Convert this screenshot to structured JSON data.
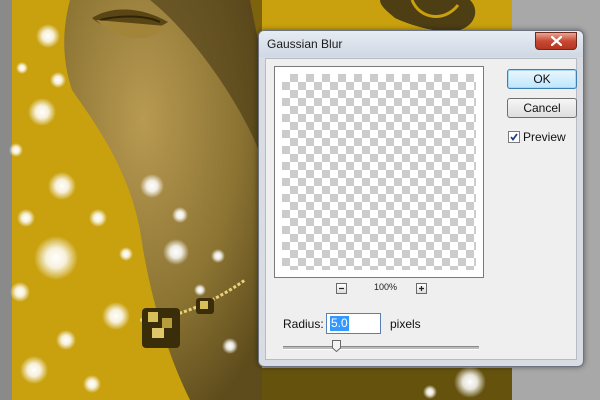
{
  "dialog": {
    "title": "Gaussian Blur",
    "ok_label": "OK",
    "cancel_label": "Cancel",
    "preview_label": "Preview",
    "preview_checked": true,
    "zoom_level": "100%",
    "radius_label": "Radius:",
    "radius_value": "5.0",
    "units_label": "pixels",
    "slider_fraction": 0.27
  },
  "colors": {
    "canvas_yellow": "#c9a10e",
    "dialog_face": "#efefef",
    "selection_highlight": "#3399ff",
    "close_button_red": "#c84a33"
  }
}
